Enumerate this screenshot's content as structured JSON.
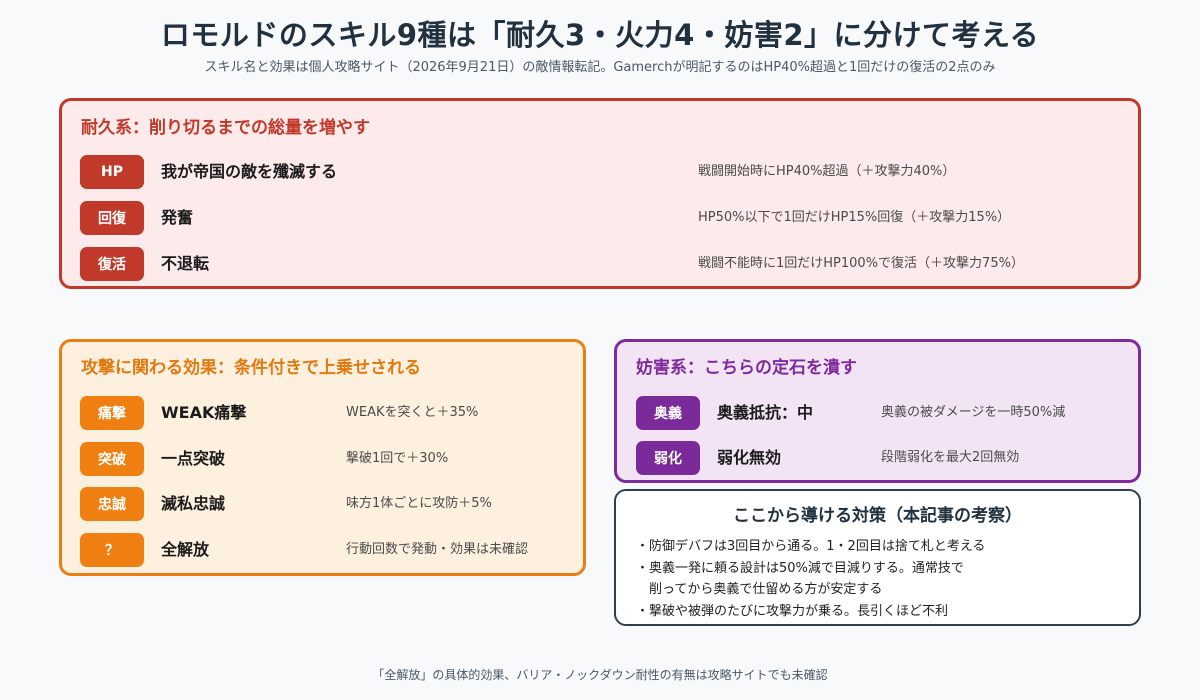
{
  "title": "ロモルドのスキル9種は「耐久3・火力4・妨害2」に分けて考える",
  "subtitle": "スキル名と効果は個人攻略サイト（2026年9月21日）の敵情報転記。Gamerchが明記するのはHP40%超過と1回だけの復活の2点のみ",
  "colors": {
    "endurance": "#c0392b",
    "attack": "#ea7e12",
    "disrupt": "#7d2a9c",
    "counter_border": "#2f3f4f"
  },
  "endurance": {
    "heading": "耐久系：削り切るまでの総量を増やす",
    "rows": [
      {
        "badge": "HP",
        "skill": "我が帝国の敵を殲滅する",
        "effect": "戦闘開始時にHP40%超過（＋攻撃力40%）"
      },
      {
        "badge": "回復",
        "skill": "発奮",
        "effect": "HP50%以下で1回だけHP15%回復（＋攻撃力15%）"
      },
      {
        "badge": "復活",
        "skill": "不退転",
        "effect": "戦闘不能時に1回だけHP100%で復活（＋攻撃力75%）"
      }
    ]
  },
  "attack": {
    "heading": "攻撃に関わる効果：条件付きで上乗せされる",
    "rows": [
      {
        "badge": "痛撃",
        "skill": "WEAK痛撃",
        "effect": "WEAKを突くと＋35%"
      },
      {
        "badge": "突破",
        "skill": "一点突破",
        "effect": "撃破1回で＋30%"
      },
      {
        "badge": "忠誠",
        "skill": "滅私忠誠",
        "effect": "味方1体ごとに攻防＋5%"
      },
      {
        "badge": "？",
        "skill": "全解放",
        "effect": "行動回数で発動・効果は未確認"
      }
    ]
  },
  "disrupt": {
    "heading": "妨害系：こちらの定石を潰す",
    "rows": [
      {
        "badge": "奥義",
        "skill": "奥義抵抗：中",
        "effect": "奥義の被ダメージを一時50%減"
      },
      {
        "badge": "弱化",
        "skill": "弱化無効",
        "effect": "段階弱化を最大2回無効"
      }
    ]
  },
  "counter": {
    "heading": "ここから導ける対策（本記事の考察）",
    "lines": [
      "・防御デバフは3回目から通る。1・2回目は捨て札と考える",
      "・奥義一発に頼る設計は50%減で目減りする。通常技で",
      "　削ってから奥義で仕留める方が安定する",
      "・撃破や被弾のたびに攻撃力が乗る。長引くほど不利"
    ]
  },
  "footnote": "「全解放」の具体的効果、バリア・ノックダウン耐性の有無は攻略サイトでも未確認"
}
